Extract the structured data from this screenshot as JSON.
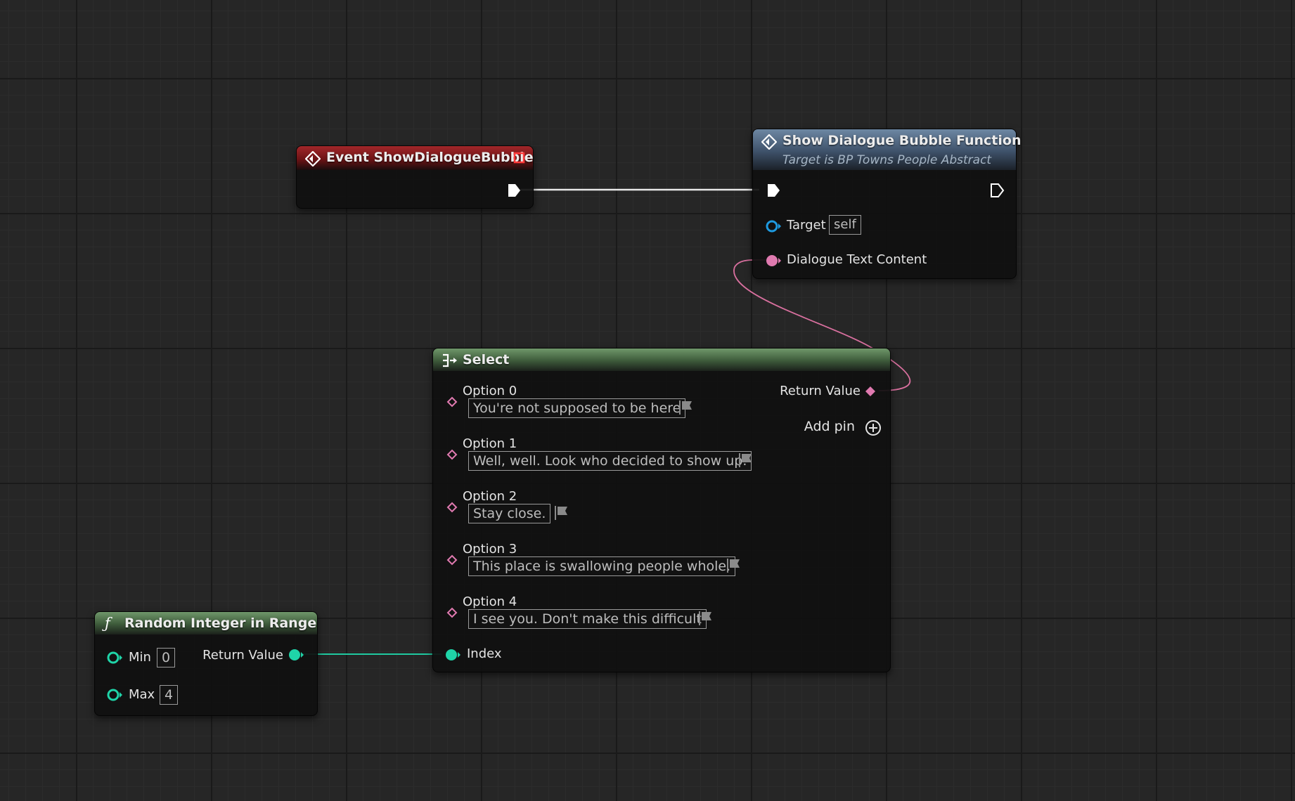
{
  "nodes": {
    "event": {
      "title": "Event ShowDialogueBubble"
    },
    "function": {
      "title": "Show Dialogue Bubble Function",
      "subtitle": "Target is BP Towns People Abstract",
      "target_label": "Target",
      "target_value": "self",
      "text_label": "Dialogue Text Content"
    },
    "select": {
      "title": "Select",
      "return_label": "Return Value",
      "add_pin_label": "Add pin",
      "index_label": "Index",
      "options": [
        {
          "label": "Option 0",
          "value": "You're not supposed to be here"
        },
        {
          "label": "Option 1",
          "value": "Well, well. Look who decided to show up."
        },
        {
          "label": "Option 2",
          "value": "Stay close."
        },
        {
          "label": "Option 3",
          "value": "This place is swallowing people whole."
        },
        {
          "label": "Option 4",
          "value": "I see you. Don't make this difficult"
        }
      ]
    },
    "random": {
      "title": "Random Integer in Range",
      "min_label": "Min",
      "min_value": "0",
      "max_label": "Max",
      "max_value": "4",
      "return_label": "Return Value"
    }
  },
  "colors": {
    "exec": "#ffffff",
    "object_pin": "#1e9ae0",
    "text_pin": "#e07ab0",
    "int_pin": "#1fd4a8",
    "wildcard_pin": "#e07ab0"
  },
  "icons": {
    "event": "event-diamond-icon",
    "function": "function-diamond-icon",
    "select": "select-arrow-icon",
    "random": "function-f-icon",
    "flag": "localize-flag-icon",
    "add": "add-circle-icon"
  }
}
